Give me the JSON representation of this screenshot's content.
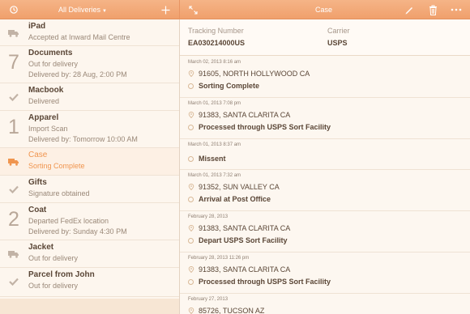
{
  "topbar": {
    "left_title": "All Deliveries",
    "right_title": "Case",
    "icons": [
      "refresh-icon",
      "plus-icon",
      "expand-icon",
      "pencil-icon",
      "trash-icon",
      "more-icon"
    ]
  },
  "sidebar": {
    "items": [
      {
        "icon": "truck-icon",
        "title": "iPad",
        "line1": "Accepted at Inward Mail Centre"
      },
      {
        "count": "7",
        "title": "Documents",
        "line1": "Out for delivery",
        "line2": "Delivered by: 28 Aug, 2:00 PM"
      },
      {
        "icon": "check-icon",
        "title": "Macbook",
        "line1": "Delivered"
      },
      {
        "count": "1",
        "title": "Apparel",
        "line1": "Import Scan",
        "line2": "Delivered by: Tomorrow 10:00 AM"
      },
      {
        "icon": "truck-icon",
        "title": "Case",
        "line1": "Sorting Complete"
      },
      {
        "icon": "check-icon",
        "title": "Gifts",
        "line1": "Signature obtained"
      },
      {
        "count": "2",
        "title": "Coat",
        "line1": "Departed FedEx location",
        "line2": "Delivered by: Sunday 4:30 PM"
      },
      {
        "icon": "truck-icon",
        "title": "Jacket",
        "line1": "Out for delivery"
      },
      {
        "icon": "check-icon",
        "title": "Parcel from John",
        "line1": "Out for delivery"
      }
    ]
  },
  "detail": {
    "tracking_label": "Tracking Number",
    "tracking_value": "EA030214000US",
    "carrier_label": "Carrier",
    "carrier_value": "USPS",
    "events": [
      {
        "date": "March 02, 2013 8:16 am",
        "location": "91605, NORTH HOLLYWOOD CA",
        "status": "Sorting Complete"
      },
      {
        "date": "March 01, 2013 7:08 pm",
        "location": "91383, SANTA CLARITA CA",
        "status": "Processed through USPS Sort Facility"
      },
      {
        "date": "March 01, 2013 8:37 am",
        "status": "Missent"
      },
      {
        "date": "March 01, 2013 7:32 am",
        "location": "91352, SUN VALLEY CA",
        "status": "Arrival at Post Office"
      },
      {
        "date": "February 28, 2013",
        "location": "91383, SANTA CLARITA CA",
        "status": "Depart USPS Sort Facility"
      },
      {
        "date": "February 28, 2013 11:26 pm",
        "location": "91383, SANTA CLARITA CA",
        "status": "Processed through USPS Sort Facility"
      },
      {
        "date": "February 27, 2013",
        "location": "85726, TUCSON AZ"
      }
    ]
  },
  "colors": {
    "accent": "#f0a06c",
    "highlight": "#f0954f",
    "background": "#fbf3ea",
    "text": "#5a4636"
  }
}
